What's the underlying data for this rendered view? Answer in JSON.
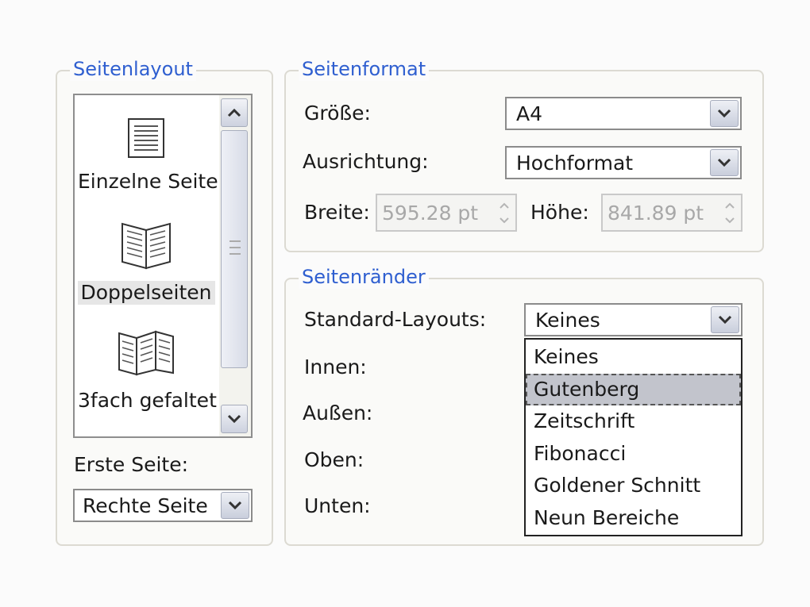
{
  "page_layout": {
    "legend": "Seitenlayout",
    "items": [
      {
        "label": "Einzelne Seite",
        "icon": "single-page-icon"
      },
      {
        "label": "Doppelseiten",
        "icon": "double-page-icon"
      },
      {
        "label": "3fach gefaltet",
        "icon": "tri-fold-icon"
      }
    ],
    "selected_item": "Doppelseiten",
    "first_page_label": "Erste Seite:",
    "first_page_value": "Rechte Seite"
  },
  "page_format": {
    "legend": "Seitenformat",
    "size_label": "Größe:",
    "size_value": "A4",
    "orientation_label": "Ausrichtung:",
    "orientation_value": "Hochformat",
    "width_label": "Breite:",
    "width_value": "595.28 pt",
    "height_label": "Höhe:",
    "height_value": "841.89 pt"
  },
  "margins": {
    "legend": "Seitenränder",
    "preset_label": "Standard-Layouts:",
    "preset_value": "Keines",
    "inner_label": "Innen:",
    "outer_label": "Außen:",
    "top_label": "Oben:",
    "bottom_label": "Unten:",
    "preset_options": [
      "Keines",
      "Gutenberg",
      "Zeitschrift",
      "Fibonacci",
      "Goldener Schnitt",
      "Neun Bereiche"
    ],
    "highlighted_option": "Gutenberg"
  },
  "colors": {
    "legend_text": "#2f5fd0",
    "group_border": "#dcdad2",
    "selection_bg": "#c2c4cc"
  }
}
